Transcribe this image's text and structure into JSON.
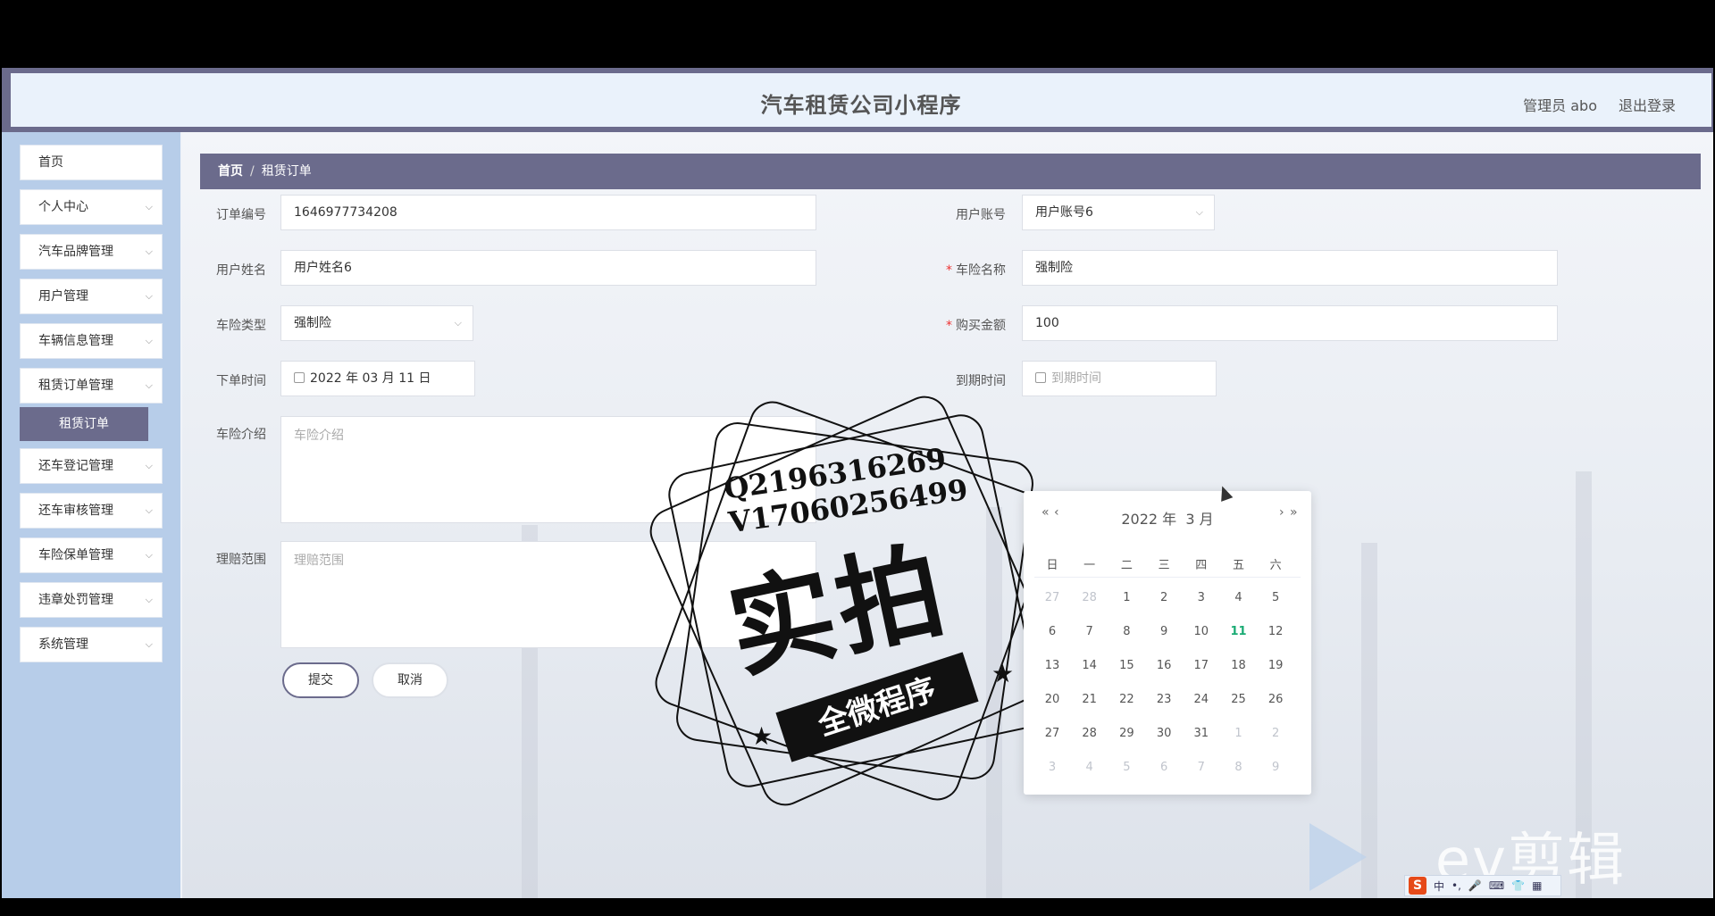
{
  "header": {
    "title": "汽车租赁公司小程序",
    "admin": "管理员 abo",
    "logout": "退出登录"
  },
  "sidebar": {
    "items": [
      {
        "label": "首页",
        "chevron": false
      },
      {
        "label": "个人中心",
        "chevron": true
      },
      {
        "label": "汽车品牌管理",
        "chevron": true
      },
      {
        "label": "用户管理",
        "chevron": true
      },
      {
        "label": "车辆信息管理",
        "chevron": true
      },
      {
        "label": "租赁订单管理",
        "chevron": true
      },
      {
        "label": "还车登记管理",
        "chevron": true
      },
      {
        "label": "还车审核管理",
        "chevron": true
      },
      {
        "label": "车险保单管理",
        "chevron": true
      },
      {
        "label": "违章处罚管理",
        "chevron": true
      },
      {
        "label": "系统管理",
        "chevron": true
      }
    ],
    "active_sub": "租赁订单"
  },
  "breadcrumb": {
    "home": "首页",
    "sep": "/",
    "current": "租赁订单"
  },
  "form": {
    "order_no": {
      "label": "订单编号",
      "value": "1646977734208"
    },
    "user_account": {
      "label": "用户账号",
      "value": "用户账号6"
    },
    "user_name": {
      "label": "用户姓名",
      "value": "用户姓名6"
    },
    "insurance_name": {
      "label": "车险名称",
      "value": "强制险"
    },
    "insurance_type": {
      "label": "车险类型",
      "value": "强制险"
    },
    "purchase_amount": {
      "label": "购买金额",
      "value": "100"
    },
    "order_time": {
      "label": "下单时间",
      "value": "2022 年 03 月 11 日"
    },
    "expire_time": {
      "label": "到期时间",
      "placeholder": "到期时间"
    },
    "insurance_intro": {
      "label": "车险介绍",
      "placeholder": "车险介绍"
    },
    "claim_scope": {
      "label": "理赔范围",
      "placeholder": "理赔范围"
    },
    "submit": "提交",
    "cancel": "取消"
  },
  "datepicker": {
    "year_label": "2022 年",
    "month_label": "3 月",
    "prev_year": "«",
    "prev_month": "‹",
    "next_month": "›",
    "next_year": "»",
    "weekdays": [
      "日",
      "一",
      "二",
      "三",
      "四",
      "五",
      "六"
    ],
    "rows": [
      [
        {
          "d": "27",
          "m": true
        },
        {
          "d": "28",
          "m": true
        },
        {
          "d": "1"
        },
        {
          "d": "2"
        },
        {
          "d": "3"
        },
        {
          "d": "4"
        },
        {
          "d": "5"
        }
      ],
      [
        {
          "d": "6"
        },
        {
          "d": "7"
        },
        {
          "d": "8"
        },
        {
          "d": "9"
        },
        {
          "d": "10"
        },
        {
          "d": "11",
          "today": true
        },
        {
          "d": "12"
        }
      ],
      [
        {
          "d": "13"
        },
        {
          "d": "14"
        },
        {
          "d": "15"
        },
        {
          "d": "16"
        },
        {
          "d": "17"
        },
        {
          "d": "18"
        },
        {
          "d": "19"
        }
      ],
      [
        {
          "d": "20"
        },
        {
          "d": "21"
        },
        {
          "d": "22"
        },
        {
          "d": "23"
        },
        {
          "d": "24"
        },
        {
          "d": "25"
        },
        {
          "d": "26"
        }
      ],
      [
        {
          "d": "27"
        },
        {
          "d": "28"
        },
        {
          "d": "29"
        },
        {
          "d": "30"
        },
        {
          "d": "31"
        },
        {
          "d": "1",
          "m": true
        },
        {
          "d": "2",
          "m": true
        }
      ],
      [
        {
          "d": "3",
          "m": true
        },
        {
          "d": "4",
          "m": true
        },
        {
          "d": "5",
          "m": true
        },
        {
          "d": "6",
          "m": true
        },
        {
          "d": "7",
          "m": true
        },
        {
          "d": "8",
          "m": true
        },
        {
          "d": "9",
          "m": true
        }
      ]
    ]
  },
  "stamp": {
    "line1": "Q2196316269",
    "line2": "V17060256499",
    "big": "实拍",
    "ribbon": "全微程序",
    "star": "★"
  },
  "watermark": {
    "text": "ev剪辑"
  },
  "ime": {
    "logo": "S",
    "items": [
      "中",
      "•,",
      "🎤",
      "⌨",
      "👕",
      "▦"
    ]
  },
  "colors": {
    "accent": "#6b6b8c",
    "sidebar": "#b7cde9",
    "header_bg": "#eaf2fb",
    "today": "#1aab74",
    "required": "#e33333"
  }
}
